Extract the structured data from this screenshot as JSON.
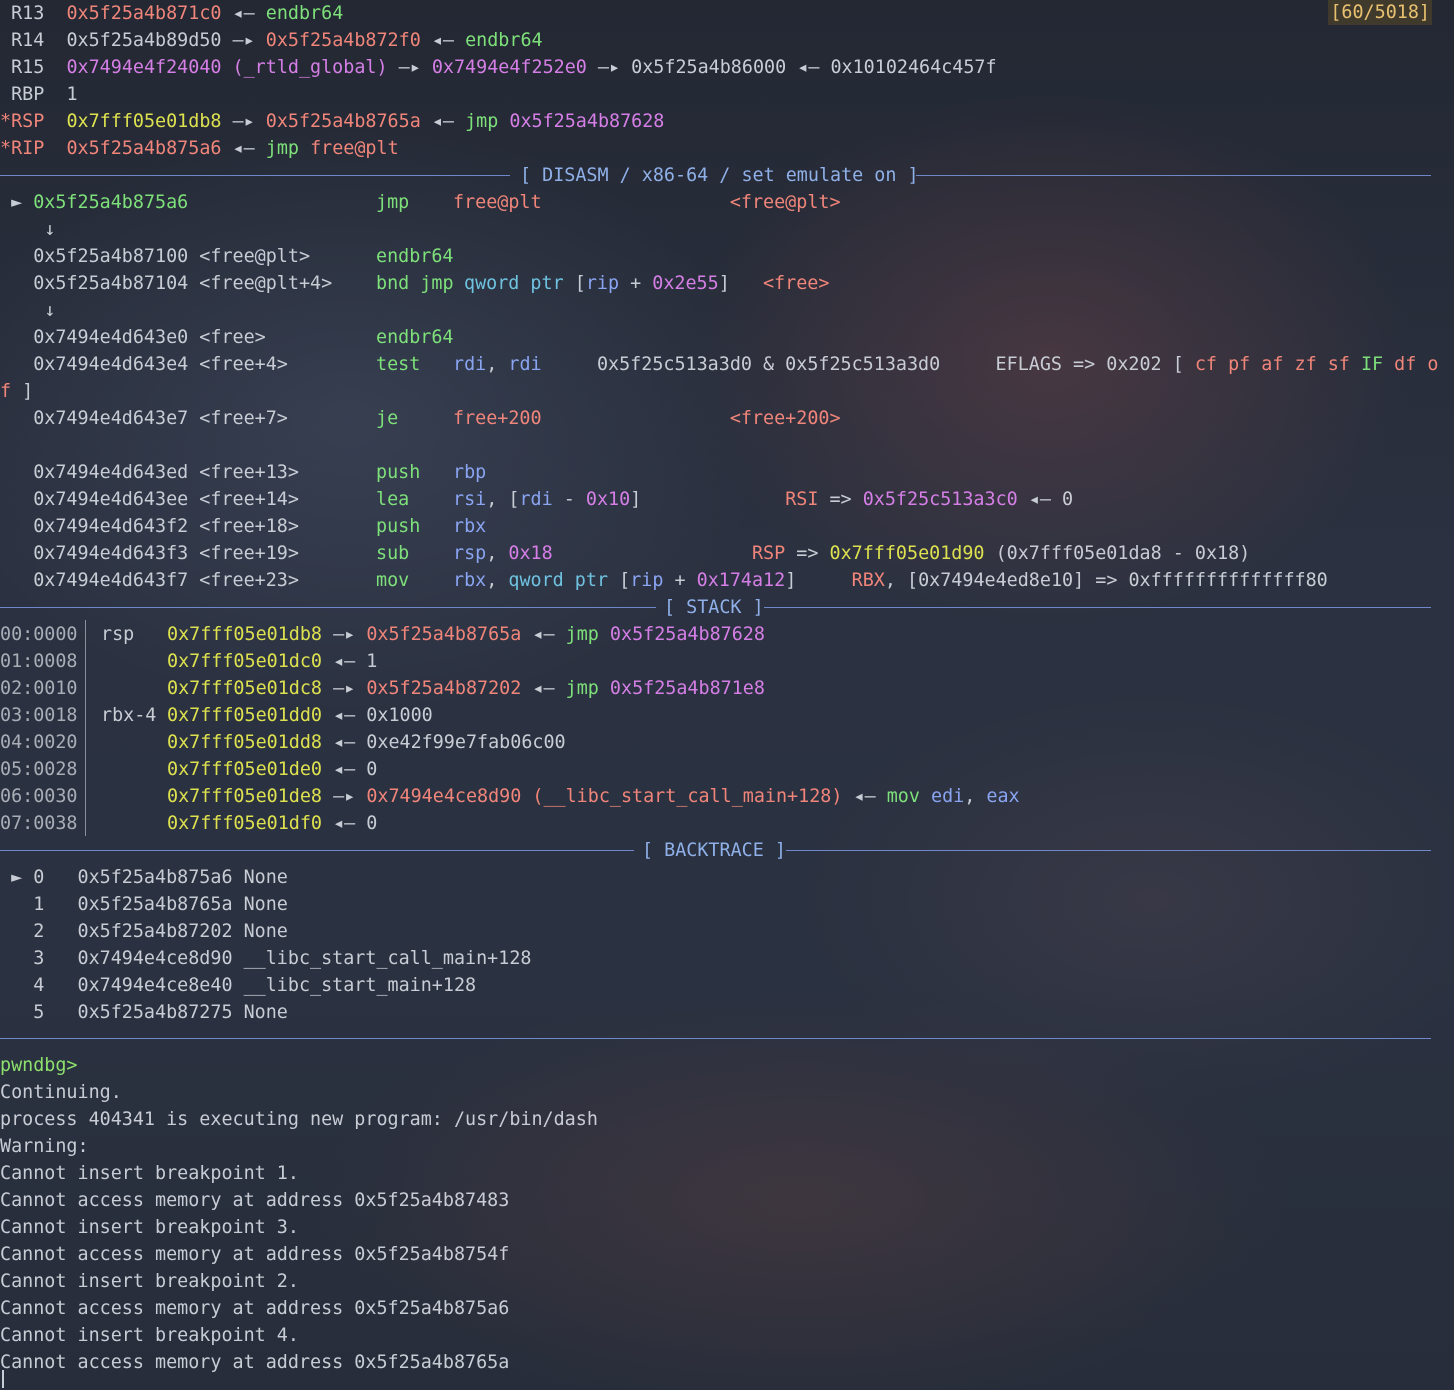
{
  "history_badge": "[60/5018]",
  "registers": [
    {
      "name": " R13",
      "parts": [
        [
          "r",
          "0x5f25a4b871c0"
        ],
        [
          "w",
          " ◂— "
        ],
        [
          "g",
          "endbr64"
        ]
      ]
    },
    {
      "name": " R14",
      "parts": [
        [
          "w",
          "0x5f25a4b89d50"
        ],
        [
          "w",
          " —▸ "
        ],
        [
          "r",
          "0x5f25a4b872f0"
        ],
        [
          "w",
          " ◂— "
        ],
        [
          "g",
          "endbr64"
        ]
      ]
    },
    {
      "name": " R15",
      "parts": [
        [
          "m",
          "0x7494e4f24040 (_rtld_global)"
        ],
        [
          "w",
          " —▸ "
        ],
        [
          "m",
          "0x7494e4f252e0"
        ],
        [
          "w",
          " —▸ "
        ],
        [
          "w",
          "0x5f25a4b86000"
        ],
        [
          "w",
          " ◂— "
        ],
        [
          "w",
          "0x10102464c457f"
        ]
      ]
    },
    {
      "name": " RBP",
      "parts": [
        [
          "w",
          "1"
        ]
      ]
    },
    {
      "name": "*RSP",
      "parts": [
        [
          "y",
          "0x7fff05e01db8"
        ],
        [
          "w",
          " —▸ "
        ],
        [
          "r",
          "0x5f25a4b8765a"
        ],
        [
          "w",
          " ◂— "
        ],
        [
          "g",
          "jmp "
        ],
        [
          "m",
          "0x5f25a4b87628"
        ]
      ]
    },
    {
      "name": "*RIP",
      "parts": [
        [
          "r",
          "0x5f25a4b875a6"
        ],
        [
          "w",
          " ◂— "
        ],
        [
          "g",
          "jmp "
        ],
        [
          "r",
          "free@plt"
        ]
      ]
    }
  ],
  "disasm_title": "[ DISASM / x86-64 / set emulate on ]",
  "disasm": [
    {
      "parts": [
        [
          "w",
          " ► "
        ],
        [
          "g",
          "0x5f25a4b875a6"
        ]
      ],
      "mn": "jmp",
      "ops": [
        [
          "r",
          "free@plt"
        ]
      ],
      "cm": [
        [
          "w",
          "                 "
        ],
        [
          "r",
          "<free@plt>"
        ]
      ]
    },
    {
      "parts": [
        [
          "w",
          "    ↓"
        ]
      ]
    },
    {
      "parts": [
        [
          "w",
          "   0x5f25a4b87100 <free@plt>"
        ]
      ],
      "mn": "endbr64"
    },
    {
      "parts": [
        [
          "w",
          "   0x5f25a4b87104 <free@plt+4>"
        ]
      ],
      "mn": "bnd jmp",
      "ops": [
        [
          "c",
          "qword ptr "
        ],
        [
          "w",
          "["
        ],
        [
          "b",
          "rip"
        ],
        [
          "w",
          " + "
        ],
        [
          "m",
          "0x2e55"
        ],
        [
          "w",
          "]"
        ]
      ],
      "cm": [
        [
          "w",
          "   "
        ],
        [
          "r",
          "<free>"
        ]
      ]
    },
    {
      "parts": [
        [
          "w",
          "    ↓"
        ]
      ]
    },
    {
      "parts": [
        [
          "w",
          "   0x7494e4d643e0 <free>"
        ]
      ],
      "mn": "endbr64"
    },
    {
      "parts": [
        [
          "w",
          "   0x7494e4d643e4 <free+4>"
        ]
      ],
      "mn": "test",
      "ops": [
        [
          "b",
          "rdi"
        ],
        [
          "w",
          ", "
        ],
        [
          "b",
          "rdi"
        ]
      ],
      "cm": [
        [
          "w",
          "     0x5f25c513a3d0 & 0x5f25c513a3d0     EFLAGS => 0x202 [ "
        ],
        [
          "r",
          "cf pf af zf sf "
        ],
        [
          "g",
          "IF"
        ],
        [
          "r",
          " df o"
        ]
      ]
    },
    {
      "parts": [
        [
          "r",
          "f "
        ],
        [
          "w",
          "]"
        ]
      ]
    },
    {
      "parts": [
        [
          "w",
          "   0x7494e4d643e7 <free+7>"
        ]
      ],
      "mn": "je",
      "ops": [
        [
          "r",
          "free+200"
        ]
      ],
      "cm": [
        [
          "w",
          "                 "
        ],
        [
          "r",
          "<free+200>"
        ]
      ]
    },
    {
      "parts": [
        [
          "w",
          ""
        ]
      ]
    },
    {
      "parts": [
        [
          "w",
          "   0x7494e4d643ed <free+13>"
        ]
      ],
      "mn": "push",
      "ops": [
        [
          "b",
          "rbp"
        ]
      ]
    },
    {
      "parts": [
        [
          "w",
          "   0x7494e4d643ee <free+14>"
        ]
      ],
      "mn": "lea",
      "ops": [
        [
          "b",
          "rsi"
        ],
        [
          "w",
          ", ["
        ],
        [
          "b",
          "rdi"
        ],
        [
          "w",
          " - "
        ],
        [
          "m",
          "0x10"
        ],
        [
          "w",
          "]"
        ]
      ],
      "cm": [
        [
          "w",
          "             "
        ],
        [
          "r",
          "RSI"
        ],
        [
          "w",
          " => "
        ],
        [
          "m",
          "0x5f25c513a3c0"
        ],
        [
          "w",
          " ◂— 0"
        ]
      ]
    },
    {
      "parts": [
        [
          "w",
          "   0x7494e4d643f2 <free+18>"
        ]
      ],
      "mn": "push",
      "ops": [
        [
          "b",
          "rbx"
        ]
      ]
    },
    {
      "parts": [
        [
          "w",
          "   0x7494e4d643f3 <free+19>"
        ]
      ],
      "mn": "sub",
      "ops": [
        [
          "b",
          "rsp"
        ],
        [
          "w",
          ", "
        ],
        [
          "m",
          "0x18"
        ]
      ],
      "cm": [
        [
          "w",
          "                  "
        ],
        [
          "r",
          "RSP"
        ],
        [
          "w",
          " => "
        ],
        [
          "y",
          "0x7fff05e01d90"
        ],
        [
          "w",
          " (0x7fff05e01da8 - 0x18)"
        ]
      ]
    },
    {
      "parts": [
        [
          "w",
          "   0x7494e4d643f7 <free+23>"
        ]
      ],
      "mn": "mov",
      "ops": [
        [
          "b",
          "rbx"
        ],
        [
          "w",
          ", "
        ],
        [
          "c",
          "qword ptr "
        ],
        [
          "w",
          "["
        ],
        [
          "b",
          "rip"
        ],
        [
          "w",
          " + "
        ],
        [
          "m",
          "0x174a12"
        ],
        [
          "w",
          "]"
        ]
      ],
      "cm": [
        [
          "w",
          "     "
        ],
        [
          "r",
          "RBX"
        ],
        [
          "w",
          ", [0x7494e4ed8e10] => 0xffffffffffffff80"
        ]
      ]
    }
  ],
  "stack_title": "[ STACK ]",
  "stack": [
    {
      "off": "00:0000",
      "reg": "rsp",
      "parts": [
        [
          "y",
          "0x7fff05e01db8"
        ],
        [
          "w",
          " —▸ "
        ],
        [
          "r",
          "0x5f25a4b8765a"
        ],
        [
          "w",
          " ◂— "
        ],
        [
          "g",
          "jmp "
        ],
        [
          "m",
          "0x5f25a4b87628"
        ]
      ]
    },
    {
      "off": "01:0008",
      "reg": "",
      "parts": [
        [
          "y",
          "0x7fff05e01dc0"
        ],
        [
          "w",
          " ◂— 1"
        ]
      ]
    },
    {
      "off": "02:0010",
      "reg": "",
      "parts": [
        [
          "y",
          "0x7fff05e01dc8"
        ],
        [
          "w",
          " —▸ "
        ],
        [
          "r",
          "0x5f25a4b87202"
        ],
        [
          "w",
          " ◂— "
        ],
        [
          "g",
          "jmp "
        ],
        [
          "m",
          "0x5f25a4b871e8"
        ]
      ]
    },
    {
      "off": "03:0018",
      "reg": "rbx-4",
      "parts": [
        [
          "y",
          "0x7fff05e01dd0"
        ],
        [
          "w",
          " ◂— 0x1000"
        ]
      ]
    },
    {
      "off": "04:0020",
      "reg": "",
      "parts": [
        [
          "y",
          "0x7fff05e01dd8"
        ],
        [
          "w",
          " ◂— 0xe42f99e7fab06c00"
        ]
      ]
    },
    {
      "off": "05:0028",
      "reg": "",
      "parts": [
        [
          "y",
          "0x7fff05e01de0"
        ],
        [
          "w",
          " ◂— 0"
        ]
      ]
    },
    {
      "off": "06:0030",
      "reg": "",
      "parts": [
        [
          "y",
          "0x7fff05e01de8"
        ],
        [
          "w",
          " —▸ "
        ],
        [
          "r",
          "0x7494e4ce8d90 (__libc_start_call_main+128)"
        ],
        [
          "w",
          " ◂— "
        ],
        [
          "g",
          "mov "
        ],
        [
          "b",
          "edi"
        ],
        [
          "w",
          ", "
        ],
        [
          "b",
          "eax"
        ]
      ]
    },
    {
      "off": "07:0038",
      "reg": "",
      "parts": [
        [
          "y",
          "0x7fff05e01df0"
        ],
        [
          "w",
          " ◂— 0"
        ]
      ]
    }
  ],
  "backtrace_title": "[ BACKTRACE ]",
  "backtrace": [
    " ► 0   0x5f25a4b875a6 None",
    "   1   0x5f25a4b8765a None",
    "   2   0x5f25a4b87202 None",
    "   3   0x7494e4ce8d90 __libc_start_call_main+128",
    "   4   0x7494e4ce8e40 __libc_start_main+128",
    "   5   0x5f25a4b87275 None"
  ],
  "prompt": "pwndbg>",
  "output": [
    "Continuing.",
    "process 404341 is executing new program: /usr/bin/dash",
    "Warning:",
    "Cannot insert breakpoint 1.",
    "Cannot access memory at address 0x5f25a4b87483",
    "Cannot insert breakpoint 3.",
    "Cannot access memory at address 0x5f25a4b8754f",
    "Cannot insert breakpoint 2.",
    "Cannot access memory at address 0x5f25a4b875a6",
    "Cannot insert breakpoint 4.",
    "Cannot access memory at address 0x5f25a4b8765a"
  ]
}
